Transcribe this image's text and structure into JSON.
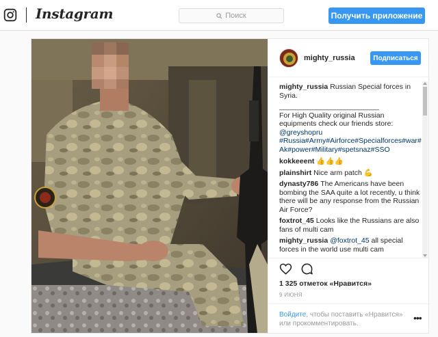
{
  "nav": {
    "logo_icon": "instagram-camera-icon",
    "wordmark": "Instagram",
    "search_placeholder": "Поиск",
    "search_icon": "magnifier-icon",
    "get_app_label": "Получить приложение"
  },
  "post": {
    "username": "mighty_russia",
    "follow_label": "Подписаться",
    "caption": {
      "username": "mighty_russia",
      "text": "Russian Special forces in Syria.",
      "separator": "_________________________",
      "body": "For High Quality original Russian equipments check our friends store:",
      "mention": "@greyshopru",
      "hashtags": "#Russia#Army#Airforce#Specialforces#war#Ak#power#Military#spetsnaz#SSO"
    },
    "comments": [
      {
        "username": "kokkeeent",
        "text": "👍👍👍"
      },
      {
        "username": "plainshirt",
        "text": "Nice arm patch 💪"
      },
      {
        "username": "dynasty786",
        "text": "The Americans have been bombing the SAA quite a lot recently, u think there will be any response from the Russian Air Force?"
      },
      {
        "username": "foxtrot_45",
        "text": "Looks like the Russians are also fans of multi cam"
      },
      {
        "username": "mighty_russia",
        "mention": "@foxtrot_45",
        "text": "all special forces in the world use multi cam"
      }
    ],
    "actions": {
      "like_icon": "heart-icon",
      "comment_icon": "comment-bubble-icon"
    },
    "likes": "1 325 отметок «Нравится»",
    "date": "9 ИЮНЯ",
    "login_link": "Войдите",
    "login_text": ", чтобы поставить «Нравится» или прокомментировать.",
    "more_icon": "ellipsis-icon"
  }
}
